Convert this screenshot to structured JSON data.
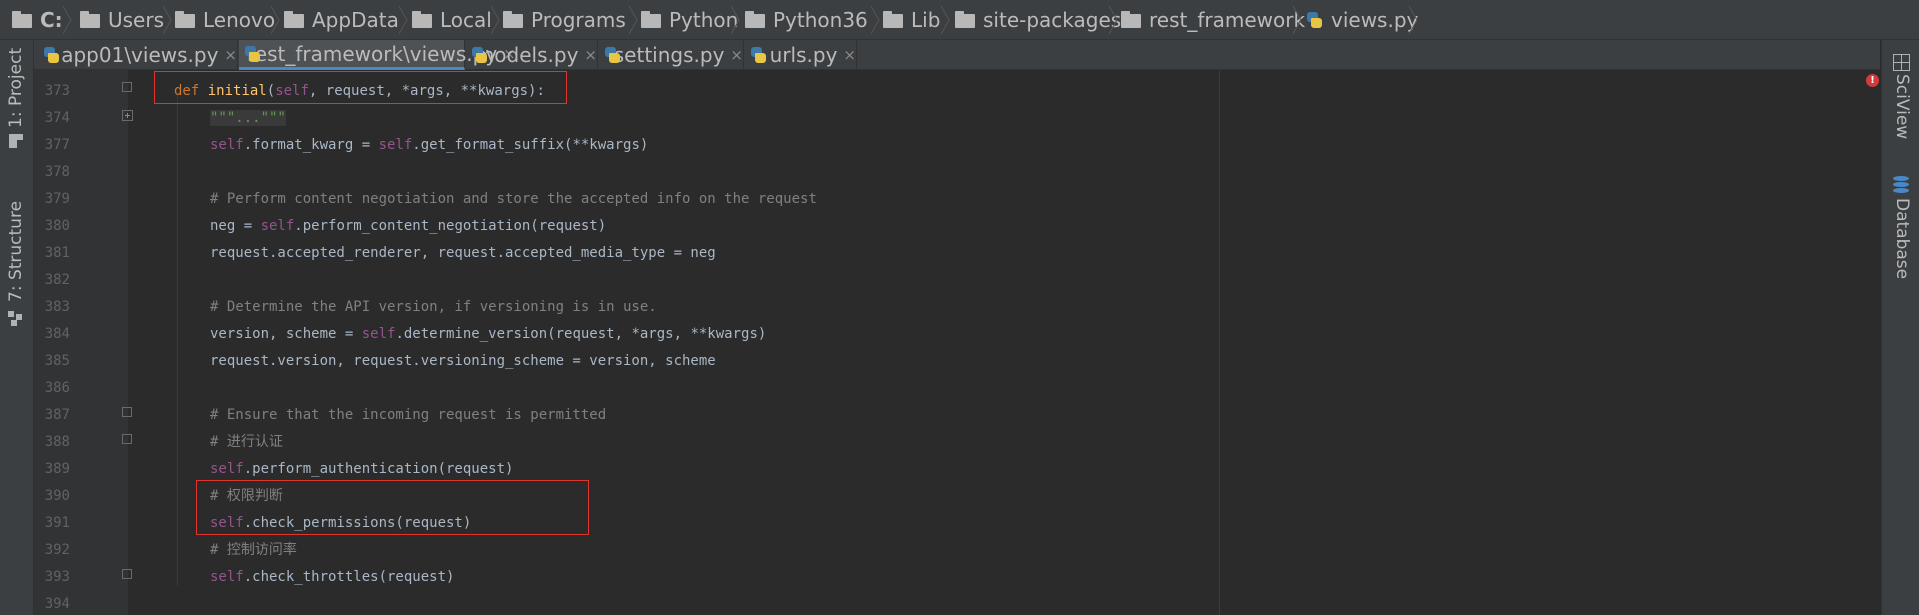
{
  "breadcrumb": {
    "items": [
      {
        "label": "C:",
        "icon": "folder-icon"
      },
      {
        "label": "Users",
        "icon": "folder-icon"
      },
      {
        "label": "Lenovo",
        "icon": "folder-icon"
      },
      {
        "label": "AppData",
        "icon": "folder-icon"
      },
      {
        "label": "Local",
        "icon": "folder-icon"
      },
      {
        "label": "Programs",
        "icon": "folder-icon"
      },
      {
        "label": "Python",
        "icon": "folder-icon"
      },
      {
        "label": "Python36",
        "icon": "folder-icon"
      },
      {
        "label": "Lib",
        "icon": "folder-icon"
      },
      {
        "label": "site-packages",
        "icon": "folder-icon"
      },
      {
        "label": "rest_framework",
        "icon": "folder-icon"
      },
      {
        "label": "views.py",
        "icon": "python-file-icon"
      }
    ]
  },
  "tabs": [
    {
      "label": "app01\\views.py",
      "active": false
    },
    {
      "label": "rest_framework\\views.py",
      "active": true
    },
    {
      "label": "models.py",
      "active": false
    },
    {
      "label": "settings.py",
      "active": false
    },
    {
      "label": "urls.py",
      "active": false
    }
  ],
  "tab_close": "×",
  "left_tool_windows": {
    "project": "1: Project",
    "structure": "7: Structure"
  },
  "right_tool_windows": {
    "sciview": "SciView",
    "database": "Database"
  },
  "editor": {
    "line_numbers": [
      "373",
      "374",
      "377",
      "378",
      "379",
      "380",
      "381",
      "382",
      "383",
      "384",
      "385",
      "386",
      "387",
      "388",
      "389",
      "390",
      "391",
      "392",
      "393",
      "394"
    ],
    "lines": {
      "l373_def": "def",
      "l373_name": "initial",
      "l373_params_open": "(",
      "l373_self": "self",
      "l373_rest": ", request, *args, **kwargs):",
      "l374_doc": "\"\"\"...\"\"\"",
      "l377_self1": "self",
      "l377_mid": ".format_kwarg = ",
      "l377_self2": "self",
      "l377_end": ".get_format_suffix(**kwargs)",
      "l379_comment": "# Perform content negotiation and store the accepted info on the request",
      "l380_start": "neg = ",
      "l380_self": "self",
      "l380_end": ".perform_content_negotiation(request)",
      "l381": "request.accepted_renderer, request.accepted_media_type = neg",
      "l383_comment": "# Determine the API version, if versioning is in use.",
      "l384_start": "version, scheme = ",
      "l384_self": "self",
      "l384_end": ".determine_version(request, *args, **kwargs)",
      "l385": "request.version, request.versioning_scheme = version, scheme",
      "l387_comment": "# Ensure that the incoming request is permitted",
      "l388_comment": "# 进行认证",
      "l389_self": "self",
      "l389_end": ".perform_authentication(request)",
      "l390_comment": "# 权限判断",
      "l391_self": "self",
      "l391_end": ".check_permissions(request)",
      "l392_comment": "# 控制访问率",
      "l393_self": "self",
      "l393_end": ".check_throttles(request)"
    }
  },
  "colors": {
    "keyword": "#cc7832",
    "function_name": "#ffc66d",
    "self": "#94558d",
    "comment": "#808080",
    "highlight_box": "#e0342d",
    "error_marker": "#d13b3b"
  }
}
